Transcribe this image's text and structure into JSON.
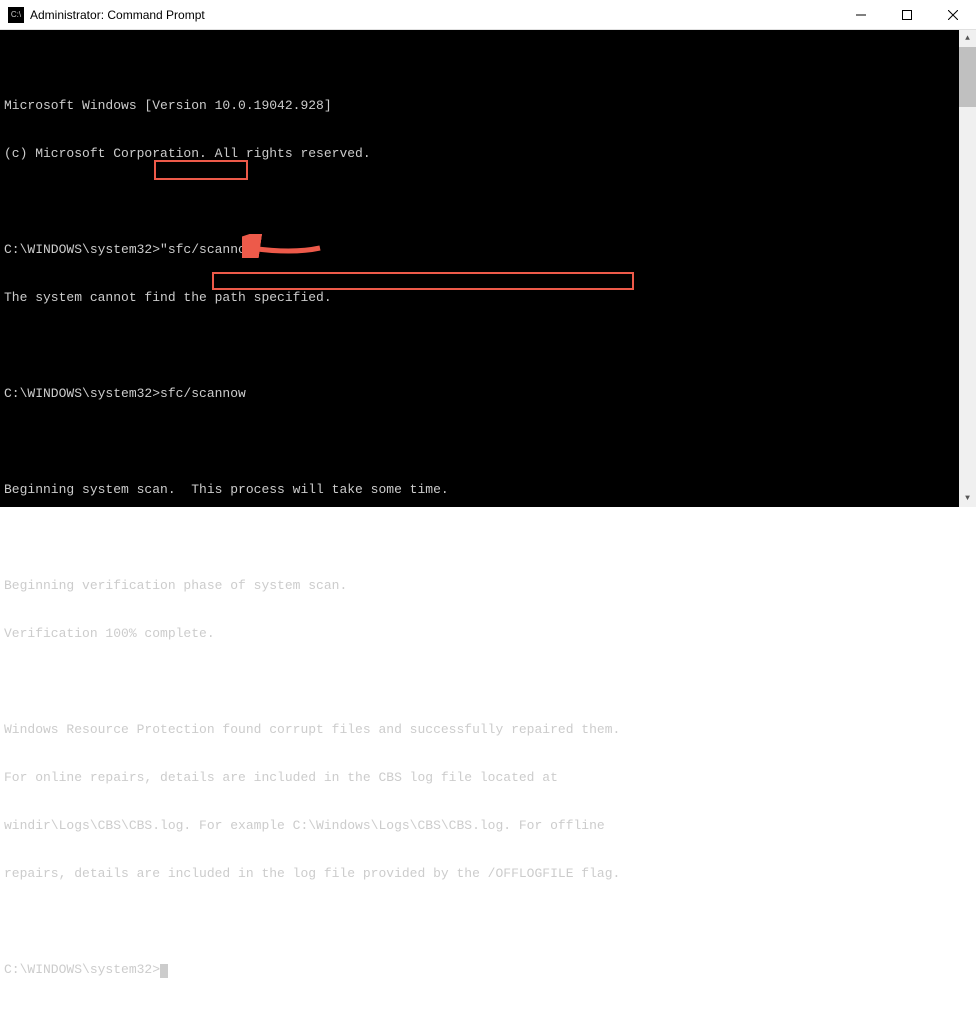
{
  "titlebar": {
    "icon_label": "C:\\",
    "title": "Administrator: Command Prompt"
  },
  "terminal": {
    "lines": [
      "Microsoft Windows [Version 10.0.19042.928]",
      "(c) Microsoft Corporation. All rights reserved.",
      "",
      "C:\\WINDOWS\\system32>\"sfc/scannow\"",
      "The system cannot find the path specified.",
      "",
      "C:\\WINDOWS\\system32>sfc/scannow",
      "",
      "Beginning system scan.  This process will take some time.",
      "",
      "Beginning verification phase of system scan.",
      "Verification 100% complete.",
      "",
      "Windows Resource Protection found corrupt files and successfully repaired them.",
      "For online repairs, details are included in the CBS log file located at",
      "windir\\Logs\\CBS\\CBS.log. For example C:\\Windows\\Logs\\CBS\\CBS.log. For offline",
      "repairs, details are included in the log file provided by the /OFFLOGFILE flag.",
      "",
      "C:\\WINDOWS\\system32>"
    ]
  },
  "annotations": {
    "highlight1_label": "sfc/scannow command highlight",
    "highlight2_label": "repair success message highlight",
    "arrow_label": "arrow pointing to verification complete"
  },
  "colors": {
    "terminal_bg": "#000000",
    "terminal_fg": "#cccccc",
    "annotation": "#ed5a4a"
  }
}
